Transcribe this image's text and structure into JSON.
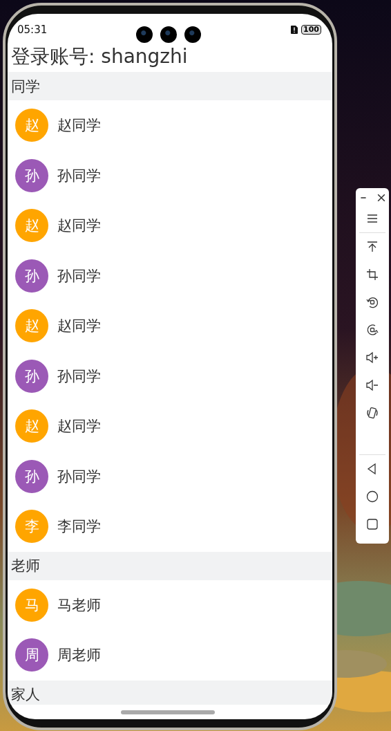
{
  "status_bar": {
    "time": "05:31",
    "battery": "100"
  },
  "title": "登录账号: shangzhi",
  "groups": [
    {
      "name": "同学",
      "contacts": [
        {
          "initial": "赵",
          "name": "赵同学",
          "color": "#ffa500"
        },
        {
          "initial": "孙",
          "name": "孙同学",
          "color": "#9b59b6"
        },
        {
          "initial": "赵",
          "name": "赵同学",
          "color": "#ffa500"
        },
        {
          "initial": "孙",
          "name": "孙同学",
          "color": "#9b59b6"
        },
        {
          "initial": "赵",
          "name": "赵同学",
          "color": "#ffa500"
        },
        {
          "initial": "孙",
          "name": "孙同学",
          "color": "#9b59b6"
        },
        {
          "initial": "赵",
          "name": "赵同学",
          "color": "#ffa500"
        },
        {
          "initial": "孙",
          "name": "孙同学",
          "color": "#9b59b6"
        },
        {
          "initial": "李",
          "name": "李同学",
          "color": "#ffa500"
        }
      ]
    },
    {
      "name": "老师",
      "contacts": [
        {
          "initial": "马",
          "name": "马老师",
          "color": "#ffa500"
        },
        {
          "initial": "周",
          "name": "周老师",
          "color": "#9b59b6"
        }
      ]
    },
    {
      "name": "家人"
    }
  ]
}
